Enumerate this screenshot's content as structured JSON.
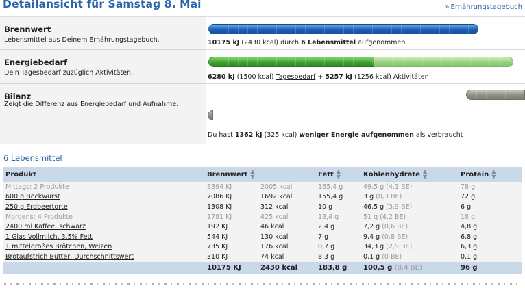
{
  "header": {
    "title": "Detailansicht für Samstag 8. Mai",
    "link_arrow": "»",
    "link_label": "Ernährungstagebuch"
  },
  "summary": {
    "brennwert": {
      "title": "Brennwert",
      "desc": "Lebensmittel aus Deinem Ernährungstagebuch.",
      "kj": "10175 kJ",
      "kcal": "(2430 kcal)",
      "middle": "durch",
      "count": "6 Lebensmittel",
      "suffix": "aufgenommen",
      "fill": 0.845
    },
    "energiebedarf": {
      "title": "Energiebedarf",
      "desc": "Dein Tagesbedarf zuzüglich Aktivitäten.",
      "kj1": "6280 kJ",
      "kcal1": "(1500 kcal)",
      "link": "Tagesbedarf",
      "plus": "+",
      "kj2": "5257 kJ",
      "kcal2": "(1256 kcal)",
      "suffix": "Aktivitäten",
      "base_fraction": 0.544
    },
    "bilanz": {
      "title": "Bilanz",
      "desc": "Zeigt die Differenz aus Energiebedarf und Aufnahme.",
      "prefix": "Du hast",
      "kj": "1362 kJ",
      "kcal": "(325 kcal)",
      "bold": "weniger Energie aufgenommen",
      "suffix": "als verbraucht"
    }
  },
  "foods": {
    "title": "6 Lebensmittel",
    "columns": [
      "Produkt",
      "Brennwert",
      "Fett",
      "Kohlenhydrate",
      "Protein"
    ],
    "rows": [
      {
        "type": "group",
        "name": "Mittags: 2 Produkte",
        "kj": "8394 KJ",
        "kcal": "2005 kcal",
        "fett": "165,4 g",
        "kh": "49,5 g",
        "be": "(4,1 BE)",
        "protein": "78 g"
      },
      {
        "type": "item",
        "name": "600 g Bockwurst",
        "kj": "7086 KJ",
        "kcal": "1692 kcal",
        "fett": "155,4 g",
        "kh": "3 g",
        "be": "(0,3 BE)",
        "protein": "72 g"
      },
      {
        "type": "item",
        "name": "250 g Erdbeertorte",
        "kj": "1308 KJ",
        "kcal": "312 kcal",
        "fett": "10 g",
        "kh": "46,5 g",
        "be": "(3,9 BE)",
        "protein": "6 g"
      },
      {
        "type": "group",
        "name": "Morgens: 4 Produkte",
        "kj": "1781 KJ",
        "kcal": "425 kcal",
        "fett": "18,4 g",
        "kh": "51 g",
        "be": "(4,2 BE)",
        "protein": "18 g"
      },
      {
        "type": "item",
        "name": "2400 ml Kaffee, schwarz",
        "kj": "192 KJ",
        "kcal": "46 kcal",
        "fett": "2,4 g",
        "kh": "7,2 g",
        "be": "(0,6 BE)",
        "protein": "4,8 g"
      },
      {
        "type": "item",
        "name": "1 Glas Vollmilch, 3,5% Fett",
        "kj": "544 KJ",
        "kcal": "130 kcal",
        "fett": "7 g",
        "kh": "9,4 g",
        "be": "(0,8 BE)",
        "protein": "6,8 g"
      },
      {
        "type": "item",
        "name": "1 mittelgroßes Brötchen, Weizen",
        "kj": "735 KJ",
        "kcal": "176 kcal",
        "fett": "0,7 g",
        "kh": "34,3 g",
        "be": "(2,9 BE)",
        "protein": "6,3 g"
      },
      {
        "type": "item",
        "name": "Brotaufstrich Butter, Durchschnittswert",
        "kj": "310 KJ",
        "kcal": "74 kcal",
        "fett": "8,3 g",
        "kh": "0,1 g",
        "be": "(0 BE)",
        "protein": "0,1 g"
      }
    ],
    "total": {
      "kj": "10175 KJ",
      "kcal": "2430 kcal",
      "fett": "183,8 g",
      "kh": "100,5 g",
      "be": "(8,4 BE)",
      "protein": "96 g"
    }
  }
}
